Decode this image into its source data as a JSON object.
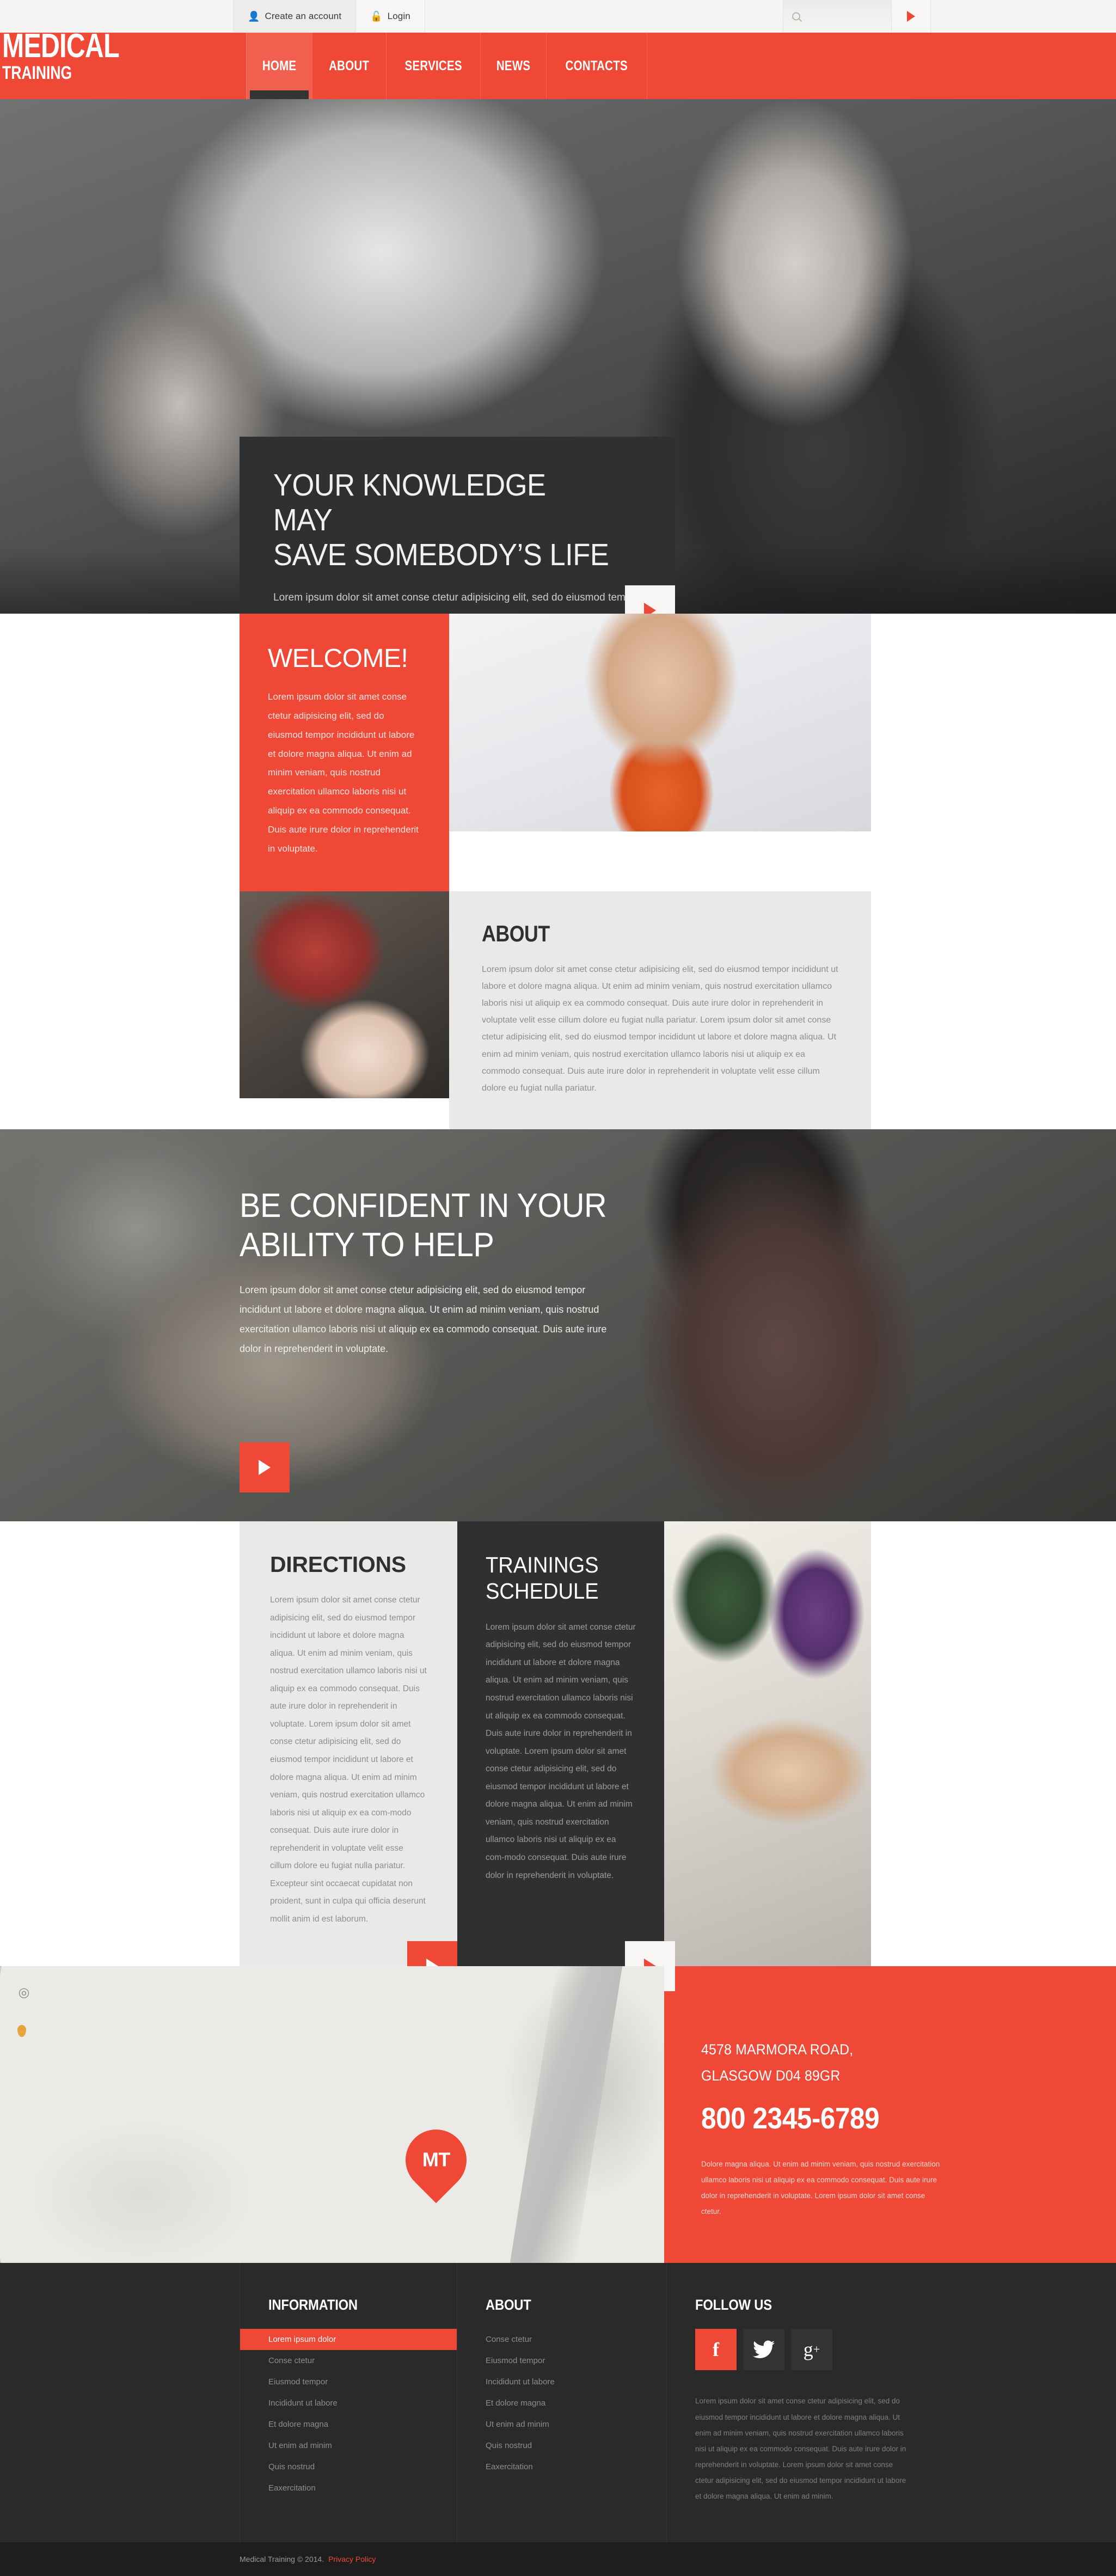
{
  "topbar": {
    "create_account": "Create an account",
    "login": "Login",
    "search_placeholder": "",
    "search_value": "",
    "icons": {
      "user": "user-icon",
      "lock": "unlock-icon",
      "search": "search-icon",
      "go": "play-arrow-icon"
    }
  },
  "header": {
    "logo_main": "MEDICAL",
    "logo_sub": "TRAINING",
    "nav": [
      {
        "label": "HOME",
        "active": true
      },
      {
        "label": "ABOUT",
        "active": false
      },
      {
        "label": "SERVICES",
        "active": false
      },
      {
        "label": "NEWS",
        "active": false
      },
      {
        "label": "CONTACTS",
        "active": false
      }
    ]
  },
  "hero1": {
    "title_line1": "YOUR KNOWLEDGE MAY",
    "title_line2": "SAVE SOMEBODY’S LIFE",
    "body": "Lorem ipsum dolor sit amet conse ctetur adipisicing elit, sed do eiusmod tempor incididunt ut labore et dolore magna aliqua. Ut enim ad minim veniam, quis nostrud exercitation ullamco laboris nisi ut aliquip ex ea commodo consequat. Duis aute irure dolor in reprehenderit in voluptate."
  },
  "welcome": {
    "title": "WELCOME!",
    "body": "Lorem ipsum dolor sit amet conse ctetur adipisicing elit, sed do eiusmod tempor incididunt ut labore et dolore magna aliqua. Ut enim ad minim veniam, quis nostrud exercitation ullamco laboris nisi ut aliquip ex ea commodo consequat. Duis aute irure dolor in reprehenderit in voluptate."
  },
  "about": {
    "title": "ABOUT",
    "body": "Lorem ipsum dolor sit amet conse ctetur adipisicing elit, sed do eiusmod tempor incididunt ut labore et dolore magna aliqua. Ut enim ad minim veniam, quis nostrud exercitation ullamco laboris nisi ut aliquip ex ea commodo consequat. Duis aute irure dolor in reprehenderit in voluptate velit esse cillum dolore eu fugiat nulla pariatur. Lorem ipsum dolor sit amet conse ctetur adipisicing elit, sed do eiusmod tempor incididunt ut labore et dolore magna aliqua. Ut enim ad minim veniam, quis nostrud exercitation ullamco laboris nisi ut aliquip ex ea commodo consequat. Duis aute irure dolor in reprehenderit in voluptate velit esse cillum dolore eu fugiat nulla pariatur."
  },
  "hero2": {
    "title_line1": "BE CONFIDENT IN YOUR",
    "title_line2": "ABILITY TO HELP",
    "body": "Lorem ipsum dolor sit amet conse ctetur adipisicing elit, sed do eiusmod tempor incididunt ut labore et dolore magna aliqua. Ut enim ad minim veniam, quis nostrud exercitation ullamco laboris nisi ut aliquip ex ea commodo consequat. Duis aute irure dolor in reprehenderit in voluptate."
  },
  "directions": {
    "title": "DIRECTIONS",
    "body": "Lorem ipsum dolor sit amet conse ctetur adipisicing elit, sed do eiusmod tempor incididunt ut labore et dolore magna aliqua. Ut enim ad minim veniam, quis nostrud exercitation ullamco laboris nisi ut aliquip ex ea commodo consequat. Duis aute irure dolor in reprehenderit in voluptate. Lorem ipsum dolor sit amet conse ctetur adipisicing elit, sed do eiusmod tempor incididunt ut labore et dolore magna aliqua. Ut enim ad minim veniam, quis nostrud exercitation ullamco laboris nisi ut aliquip ex ea com-modo consequat. Duis aute irure dolor in reprehenderit in voluptate velit esse cillum dolore eu fugiat nulla pariatur. Excepteur sint occaecat cupidatat non proident, sunt in culpa qui officia deserunt mollit anim id est laborum."
  },
  "trainings": {
    "title_line1": "TRAININGS",
    "title_line2": "SCHEDULE",
    "body": "Lorem ipsum dolor sit amet conse ctetur adipisicing elit, sed do eiusmod tempor incididunt ut labore et dolore magna aliqua. Ut enim ad minim veniam, quis nostrud exercitation ullamco laboris nisi ut aliquip ex ea commodo consequat. Duis aute irure dolor in reprehenderit in voluptate. Lorem ipsum dolor sit amet conse ctetur adipisicing elit, sed do eiusmod tempor incididunt ut labore et dolore magna aliqua. Ut enim ad minim veniam, quis nostrud exercitation ullamco laboris nisi ut aliquip ex ea com-modo consequat. Duis aute irure dolor in reprehenderit in voluptate."
  },
  "map": {
    "pin_label": "MT",
    "zoom_icon": "crosshair-icon"
  },
  "contact": {
    "address_line1": "4578 MARMORA ROAD,",
    "address_line2": "GLASGOW D04 89GR",
    "phone": "800 2345-6789",
    "body": "Dolore magna aliqua. Ut enim ad minim veniam, quis nostrud exercitation ullamco laboris nisi ut aliquip ex ea commodo consequat. Duis aute irure dolor in reprehenderit in voluptate. Lorem ipsum dolor sit amet conse ctetur."
  },
  "footer": {
    "information": {
      "title": "INFORMATION",
      "items": [
        {
          "label": "Lorem ipsum dolor",
          "active": true
        },
        {
          "label": "Conse ctetur",
          "active": false
        },
        {
          "label": "Eiusmod tempor",
          "active": false
        },
        {
          "label": "Incididunt ut labore",
          "active": false
        },
        {
          "label": "Et dolore magna",
          "active": false
        },
        {
          "label": "Ut enim ad minim",
          "active": false
        },
        {
          "label": "Quis nostrud",
          "active": false
        },
        {
          "label": "Eaxercitation",
          "active": false
        }
      ]
    },
    "about": {
      "title": "ABOUT",
      "items": [
        {
          "label": "Conse ctetur"
        },
        {
          "label": "Eiusmod tempor"
        },
        {
          "label": "Incididunt ut labore"
        },
        {
          "label": "Et dolore magna"
        },
        {
          "label": "Ut enim ad minim"
        },
        {
          "label": "Quis nostrud"
        },
        {
          "label": "Eaxercitation"
        }
      ]
    },
    "follow": {
      "title": "FOLLOW US",
      "socials": [
        {
          "name": "facebook-icon",
          "glyph": "f"
        },
        {
          "name": "twitter-icon",
          "glyph": "\u0001"
        },
        {
          "name": "google-plus-icon",
          "glyph": "g+"
        }
      ],
      "body": "Lorem ipsum dolor sit amet conse ctetur adipisicing elit, sed do eiusmod tempor incididunt ut labore et dolore magna aliqua. Ut enim ad minim veniam, quis nostrud exercitation ullamco laboris nisi ut aliquip ex ea commodo consequat. Duis aute irure dolor in reprehenderit in voluptate. Lorem ipsum dolor sit amet conse ctetur adipisicing elit, sed do eiusmod tempor incididunt ut labore et dolore magna aliqua. Ut enim ad minim."
    },
    "copyright": "Medical Training © 2014.",
    "privacy": "Privacy Policy"
  },
  "colors": {
    "accent": "#ef4836",
    "dark": "#2f3031",
    "footer_bg": "#2a2a2a",
    "copy_bg": "#1e1e1e",
    "light_panel": "#e9e9e9"
  }
}
